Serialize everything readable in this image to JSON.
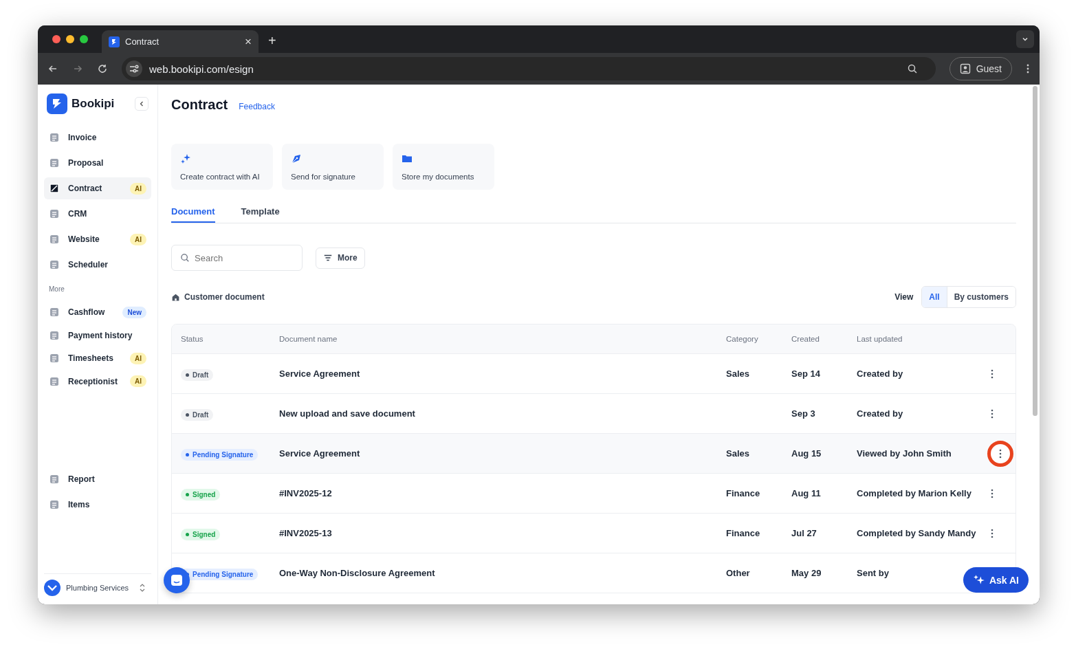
{
  "browser": {
    "tab_title": "Contract",
    "tab_close": "×",
    "new_tab": "+",
    "url": "web.bookipi.com/esign",
    "profile": "Guest"
  },
  "sidebar": {
    "brand": "Bookipi",
    "items": [
      {
        "label": "Invoice",
        "selected": false
      },
      {
        "label": "Proposal",
        "selected": false
      },
      {
        "label": "Contract",
        "selected": true,
        "badge": {
          "text": "AI",
          "kind": "ai"
        }
      },
      {
        "label": "CRM",
        "selected": false
      },
      {
        "label": "Website",
        "selected": false,
        "badge": {
          "text": "AI",
          "kind": "ai"
        }
      },
      {
        "label": "Scheduler",
        "selected": false
      }
    ],
    "section_label": "More",
    "more_items": [
      {
        "label": "Cashflow",
        "selected": false,
        "badge": {
          "text": "New",
          "kind": "new"
        }
      },
      {
        "label": "Payment history",
        "selected": false
      },
      {
        "label": "Timesheets",
        "selected": false,
        "badge": {
          "text": "AI",
          "kind": "ai"
        }
      },
      {
        "label": "Receptionist",
        "selected": false,
        "badge": {
          "text": "AI",
          "kind": "ai"
        }
      }
    ],
    "bottom_items": [
      {
        "label": "Report",
        "selected": false
      },
      {
        "label": "Items",
        "selected": false
      }
    ],
    "account": "Plumbing Services"
  },
  "page": {
    "title": "Contract",
    "feedback_link": "Feedback",
    "actions": [
      "Create contract with AI",
      "Send for signature",
      "Store my documents"
    ],
    "tabs": [
      {
        "label": "Document",
        "selected": true
      },
      {
        "label": "Template",
        "selected": false
      }
    ],
    "search": {
      "placeholder": "Search"
    },
    "more_button": "More",
    "section_title": "Customer document",
    "view": {
      "label": "View",
      "options": [
        {
          "label": "All",
          "selected": true
        },
        {
          "label": "By customers",
          "selected": false
        }
      ]
    },
    "table": {
      "columns": [
        "Status",
        "Document name",
        "Category",
        "Created",
        "Last updated"
      ],
      "rows": [
        {
          "status": {
            "text": "Draft",
            "kind": "draft"
          },
          "name": "Service Agreement",
          "category": "Sales",
          "created": "Sep 14",
          "last_updated": "Created by",
          "highlighted": false
        },
        {
          "status": {
            "text": "Draft",
            "kind": "draft"
          },
          "name": "New upload and save document",
          "category": "",
          "created": "Sep 3",
          "last_updated": "Created by",
          "highlighted": false
        },
        {
          "status": {
            "text": "Pending Signature",
            "kind": "pending"
          },
          "name": "Service Agreement",
          "category": "Sales",
          "created": "Aug 15",
          "last_updated": "Viewed by John Smith",
          "highlighted": true
        },
        {
          "status": {
            "text": "Signed",
            "kind": "signed"
          },
          "name": "#INV2025-12",
          "category": "Finance",
          "created": "Aug 11",
          "last_updated": "Completed by Marion Kelly",
          "highlighted": false
        },
        {
          "status": {
            "text": "Signed",
            "kind": "signed"
          },
          "name": "#INV2025-13",
          "category": "Finance",
          "created": "Jul 27",
          "last_updated": "Completed by Sandy Mandy",
          "highlighted": false
        },
        {
          "status": {
            "text": "Pending Signature",
            "kind": "pending"
          },
          "name": "One-Way Non-Disclosure Agreement",
          "category": "Other",
          "created": "May 29",
          "last_updated": "Sent by",
          "highlighted": false
        }
      ]
    }
  },
  "ask_ai_button": "Ask AI"
}
